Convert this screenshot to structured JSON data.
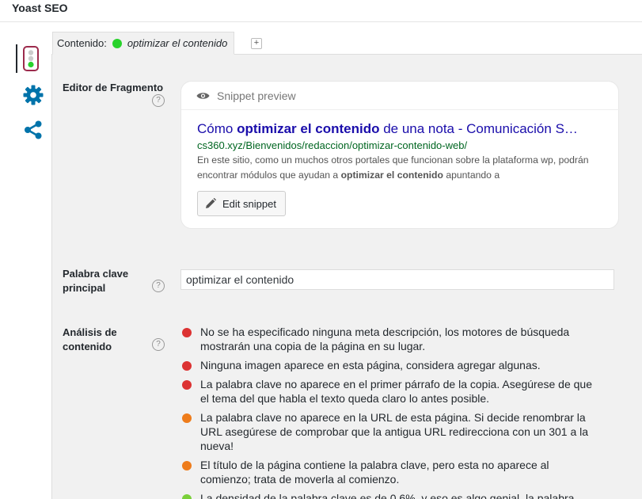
{
  "panel": {
    "title": "Yoast SEO"
  },
  "tabs": [
    {
      "label": "Contenido:",
      "keyword": "optimizar el contenido",
      "status_color": "#28d22b"
    }
  ],
  "tab_add_label": "+",
  "sidebar": {
    "items": [
      {
        "icon": "traffic-light-icon",
        "active": true
      },
      {
        "icon": "gear-icon",
        "active": false
      },
      {
        "icon": "share-icon",
        "active": false
      }
    ]
  },
  "help_glyph": "?",
  "snippet_section": {
    "label": "Editor de Fragmento",
    "preview_header": "Snippet preview",
    "title_pre": "Cómo ",
    "title_bold": "optimizar el contenido",
    "title_post": " de una nota - Comunicación S…",
    "url": "cs360.xyz/Bienvenidos/redaccion/optimizar-contenido-web/",
    "desc_pre": "En este sitio, como un muchos otros portales que funcionan sobre la plataforma wp, podrán encontrar módulos que ayudan a ",
    "desc_bold": "optimizar el contenido",
    "desc_post": " apuntando a",
    "edit_button": "Edit snippet"
  },
  "keyword_section": {
    "label_line1": "Palabra clave",
    "label_line2": "principal",
    "value": "optimizar el contenido"
  },
  "analysis_section": {
    "label_line1": "Análisis de",
    "label_line2": "contenido",
    "items": [
      {
        "status": "bad",
        "color": "#dc3232",
        "text": "No se ha especificado ninguna meta descripción, los motores de búsqueda mostrarán una copia de la página en su lugar."
      },
      {
        "status": "bad",
        "color": "#dc3232",
        "text": "Ninguna imagen aparece en esta página, considera agregar algunas."
      },
      {
        "status": "bad",
        "color": "#dc3232",
        "text": "La palabra clave no aparece en el primer párrafo de la copia. Asegúrese de que el tema del que habla el texto queda claro lo antes posible."
      },
      {
        "status": "ok",
        "color": "#ee7c1b",
        "text": "La palabra clave no aparece en la URL de esta página. Si decide renombrar la URL asegúrese de comprobar que la antigua URL redirecciona con un 301 a la nueva!"
      },
      {
        "status": "ok",
        "color": "#ee7c1b",
        "text": "El título de la página contiene la palabra clave, pero esta no aparece al comienzo; trata de moverla al comienzo."
      },
      {
        "status": "good",
        "color": "#7ad03a",
        "text": "La densidad de la palabra clave es de 0.6%, y eso es algo genial, la palabra"
      }
    ]
  }
}
